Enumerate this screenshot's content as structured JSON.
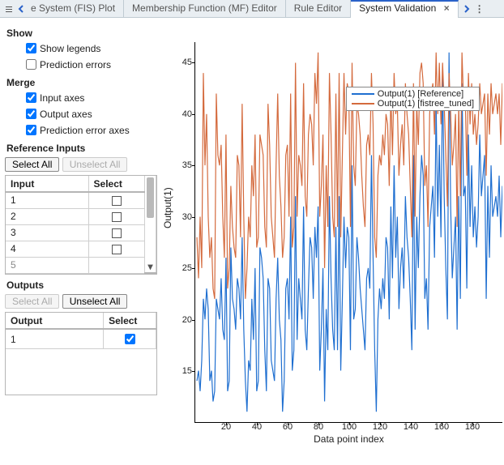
{
  "tabs": {
    "clipped": "e System (FIS) Plot",
    "mf": "Membership Function (MF) Editor",
    "rule": "Rule Editor",
    "sv": "System Validation"
  },
  "side": {
    "show": "Show",
    "show_legends": "Show legends",
    "pred_errors": "Prediction errors",
    "merge": "Merge",
    "input_axes": "Input axes",
    "output_axes": "Output axes",
    "pred_err_axes": "Prediction error axes",
    "ref_inputs": "Reference Inputs",
    "select_all": "Select All",
    "unselect_all": "Unselect All",
    "input_hdr": "Input",
    "select_hdr": "Select",
    "inputs": {
      "r1": "1",
      "r2": "2",
      "r3": "3",
      "r4": "4",
      "r5": "5"
    },
    "outputs_title": "Outputs",
    "output_hdr": "Output",
    "outputs": {
      "r1": "1"
    }
  },
  "chart_data": {
    "type": "line",
    "title": "",
    "xlabel": "Data point index",
    "ylabel": "Output(1)",
    "xlim": [
      0,
      200
    ],
    "ylim": [
      10,
      47
    ],
    "xticks": [
      20,
      40,
      60,
      80,
      100,
      120,
      140,
      160,
      180
    ],
    "yticks": [
      15,
      20,
      25,
      30,
      35,
      40,
      45
    ],
    "legend": [
      "Output(1) [Reference]",
      "Output(1) [fistree_tuned]"
    ],
    "colors": {
      "ref": "#1f6fd0",
      "tuned": "#d46a3d"
    },
    "series": [
      {
        "name": "Output(1) [Reference]",
        "color": "#1f6fd0",
        "values": [
          14,
          15,
          13,
          16,
          22,
          20,
          23,
          21,
          14,
          15,
          12,
          13,
          22,
          21,
          20,
          24,
          19,
          18,
          26,
          13,
          14,
          27,
          22,
          21,
          19,
          24,
          23,
          20,
          28,
          19,
          14,
          11,
          16,
          15,
          22,
          18,
          25,
          13,
          14,
          27,
          26,
          24,
          17,
          13,
          24,
          23,
          16,
          15,
          14,
          22,
          26,
          20,
          18,
          11,
          14,
          23,
          24,
          20,
          30,
          15,
          17,
          32,
          18,
          24,
          22,
          20,
          31,
          19,
          17,
          23,
          28,
          27,
          22,
          29,
          26,
          31,
          15,
          19,
          25,
          12,
          21,
          17,
          32,
          24,
          19,
          17,
          29,
          17,
          32,
          15,
          22,
          30,
          25,
          29,
          28,
          17,
          35,
          20,
          21,
          28,
          26,
          23,
          21,
          19,
          17,
          24,
          25,
          23,
          36,
          26,
          17,
          11,
          20,
          23,
          21,
          24,
          22,
          28,
          27,
          20,
          31,
          24,
          35,
          26,
          30,
          21,
          25,
          27,
          23,
          32,
          28,
          26,
          22,
          17,
          36,
          19,
          30,
          25,
          32,
          36,
          34,
          22,
          24,
          19,
          29,
          31,
          33,
          26,
          41,
          30,
          37,
          28,
          44,
          32,
          25,
          20,
          46,
          31,
          24,
          27,
          30,
          19,
          32,
          22,
          43,
          32,
          33,
          23,
          38,
          29,
          35,
          28,
          31,
          27,
          30,
          38,
          32,
          34,
          36,
          22,
          33,
          26,
          35,
          30,
          31,
          32,
          30,
          34,
          28,
          33
        ]
      },
      {
        "name": "Output(1) [fistree_tuned]",
        "color": "#d46a3d",
        "values": [
          28,
          24,
          30,
          25,
          44,
          35,
          40,
          30,
          26,
          28,
          23,
          22,
          42,
          36,
          35,
          37,
          30,
          26,
          38,
          23,
          25,
          33,
          29,
          27,
          26,
          36,
          35,
          28,
          41,
          30,
          22,
          25,
          30,
          28,
          35,
          32,
          38,
          27,
          28,
          38,
          37,
          36,
          29,
          27,
          41,
          37,
          30,
          28,
          26,
          35,
          42,
          34,
          31,
          26,
          28,
          36,
          37,
          30,
          42,
          27,
          29,
          45,
          30,
          36,
          35,
          33,
          43,
          32,
          30,
          38,
          40,
          39,
          35,
          44,
          41,
          46,
          30,
          33,
          38,
          25,
          35,
          29,
          44,
          38,
          30,
          28,
          42,
          29,
          44,
          28,
          36,
          44,
          38,
          43,
          42,
          29,
          45,
          35,
          33,
          41,
          40,
          38,
          34,
          31,
          29,
          37,
          38,
          36,
          44,
          39,
          28,
          26,
          34,
          36,
          35,
          38,
          36,
          40,
          39,
          33,
          42,
          36,
          44,
          40,
          41,
          34,
          37,
          39,
          35,
          43,
          40,
          38,
          33,
          28,
          43,
          30,
          41,
          37,
          44,
          45,
          43,
          33,
          35,
          29,
          40,
          42,
          43,
          38,
          46,
          40,
          45,
          39,
          45,
          41,
          36,
          31,
          44,
          40,
          35,
          37,
          40,
          29,
          41,
          32,
          46,
          41,
          42,
          34,
          44,
          39,
          43,
          38,
          40,
          37,
          39,
          43,
          40,
          41,
          42,
          34,
          42,
          38,
          43,
          40,
          41,
          42,
          40,
          42,
          37,
          43
        ]
      }
    ]
  }
}
